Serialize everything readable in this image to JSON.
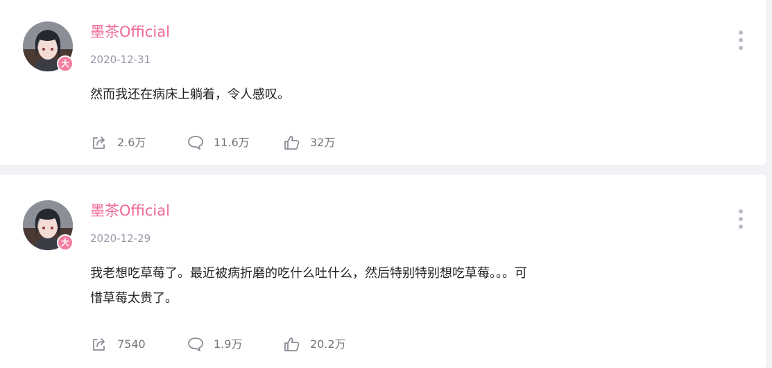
{
  "posts": [
    {
      "author": "墨茶Official",
      "badge": "大",
      "date": "2020-12-31",
      "content_lines": [
        "然而我还在病床上躺着，令人感叹。"
      ],
      "stats": {
        "share": "2.6万",
        "comment": "11.6万",
        "like": "32万"
      }
    },
    {
      "author": "墨茶Official",
      "badge": "大",
      "date": "2020-12-29",
      "content_lines": [
        "我老想吃草莓了。最近被病折磨的吃什么吐什么，然后特别特别想吃草莓。。。可",
        "惜草莓太贵了。"
      ],
      "stats": {
        "share": "7540",
        "comment": "1.9万",
        "like": "20.2万"
      }
    }
  ],
  "colors": {
    "author": "#f06a93",
    "badge": "#f47ea0",
    "meta": "#999aaa",
    "text": "#222222",
    "icon": "#8a8d96",
    "page_bg": "#f1f2f5"
  }
}
